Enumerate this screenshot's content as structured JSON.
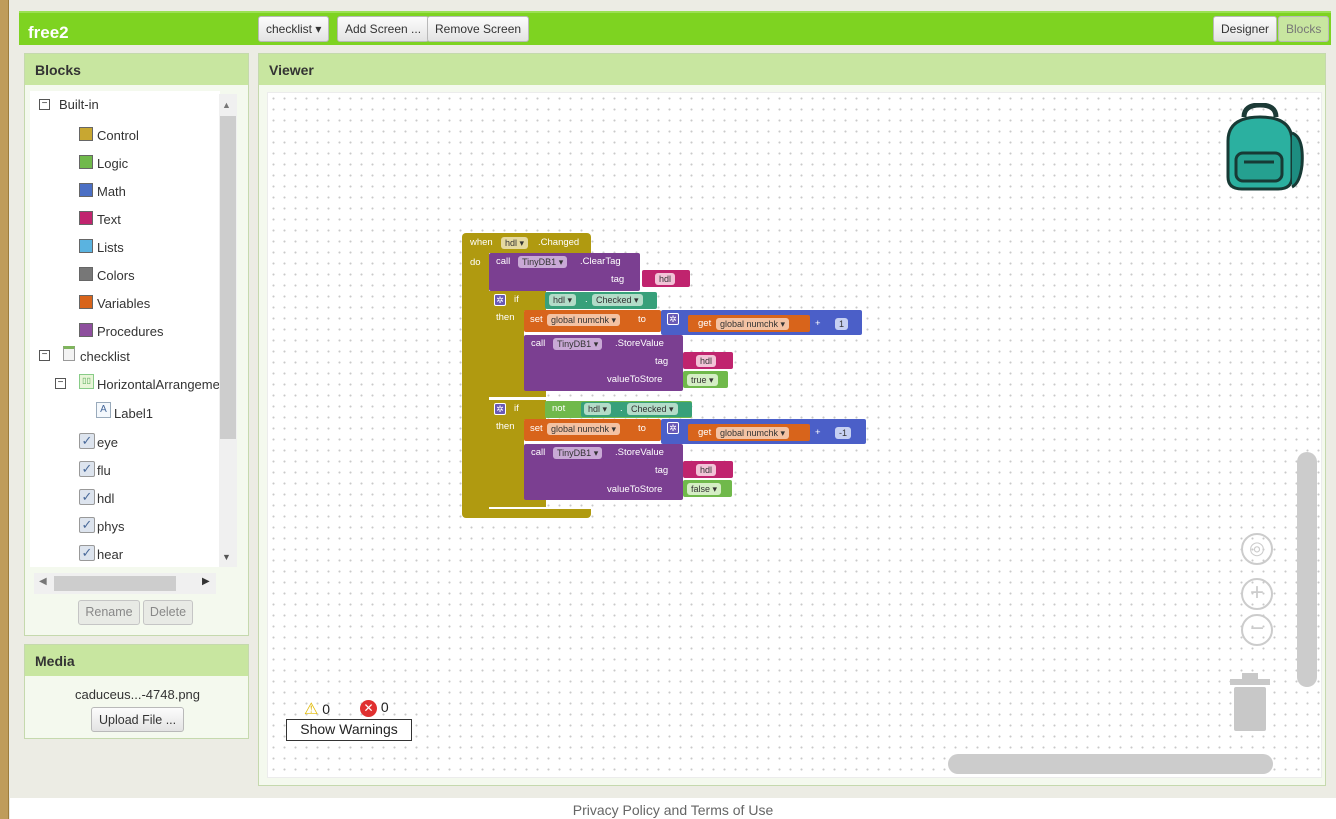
{
  "app": {
    "name": "free2"
  },
  "toolbar": {
    "screen_select": "checklist ▾",
    "add_screen": "Add Screen ...",
    "remove_screen": "Remove Screen",
    "designer": "Designer",
    "blocks": "Blocks"
  },
  "blocks_panel": {
    "title": "Blocks",
    "builtin_label": "Built-in",
    "builtin": [
      {
        "label": "Control",
        "color": "#c8a731"
      },
      {
        "label": "Logic",
        "color": "#70b94b"
      },
      {
        "label": "Math",
        "color": "#4b6fc4"
      },
      {
        "label": "Text",
        "color": "#c0246e"
      },
      {
        "label": "Lists",
        "color": "#5ab3e0"
      },
      {
        "label": "Colors",
        "color": "#777777"
      },
      {
        "label": "Variables",
        "color": "#d8641b"
      },
      {
        "label": "Procedures",
        "color": "#8e4f9e"
      }
    ],
    "screen_label": "checklist",
    "arrangement_label": "HorizontalArrangeme",
    "label1": "Label1",
    "components": [
      "eye",
      "flu",
      "hdl",
      "phys",
      "hear"
    ],
    "rename": "Rename",
    "delete": "Delete"
  },
  "media": {
    "title": "Media",
    "file": "caduceus...-4748.png",
    "upload": "Upload File ..."
  },
  "viewer": {
    "title": "Viewer"
  },
  "code": {
    "when": "when",
    "do": "do",
    "component": "hdl",
    "event": ".Changed",
    "call": "call",
    "tinydb": "TinyDB1",
    "clear_tag": ".ClearTag",
    "tag": "tag",
    "if": "if",
    "then": "then",
    "checked": "Checked",
    "not": "not",
    "set": "set",
    "to": "to",
    "get": "get",
    "global_var": "global numchk",
    "plus": "+",
    "one": "1",
    "neg_one": "-1",
    "store_value": ".StoreValue",
    "value_to_store": "valueToStore",
    "true_val": "true",
    "false_val": "false",
    "dot": "."
  },
  "warnings": {
    "warning_count": "0",
    "error_count": "0",
    "show_warnings": "Show Warnings"
  },
  "footer": {
    "text": "Privacy Policy and Terms of Use"
  }
}
